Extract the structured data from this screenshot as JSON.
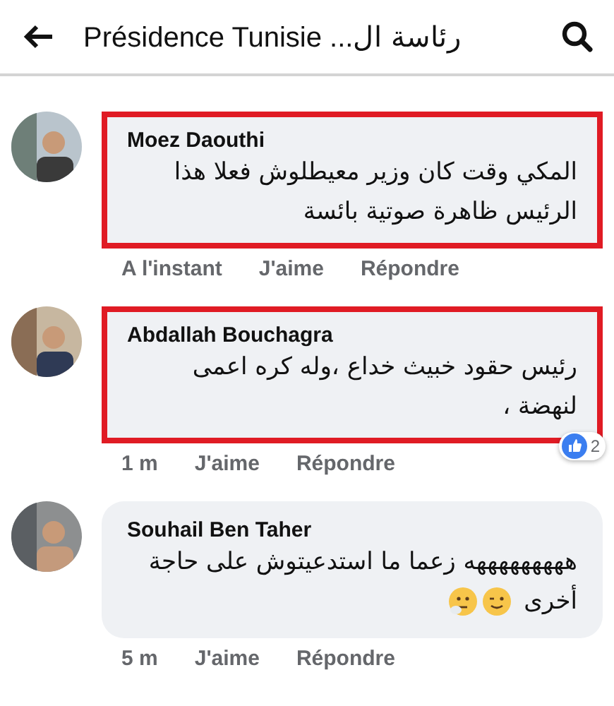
{
  "header": {
    "title": "Présidence Tunisie ...رئاسة ال"
  },
  "comments": [
    {
      "author": "Moez Daouthi",
      "lines": [
        "المكي وقت كان وزير معيطلوش فعلا هذا",
        "الرئيس ظاهرة صوتية بائسة"
      ],
      "highlighted": true,
      "time": "A l'instant",
      "like": "J'aime",
      "reply": "Répondre"
    },
    {
      "author": "Abdallah Bouchagra",
      "lines": [
        "رئيس حقود خبيث خداع ،وله كره اعمى",
        "لنهضة ،"
      ],
      "highlighted": true,
      "time": "1 m",
      "like": "J'aime",
      "reply": "Répondre",
      "reactions": {
        "count": "2"
      }
    },
    {
      "author": "Souhail Ben Taher",
      "lines": [
        "هههههههههه زعما ما استدعيتوش على حاجة",
        "أخرى"
      ],
      "highlighted": false,
      "emoji_end": true,
      "time": "5 m",
      "like": "J'aime",
      "reply": "Répondre"
    }
  ]
}
